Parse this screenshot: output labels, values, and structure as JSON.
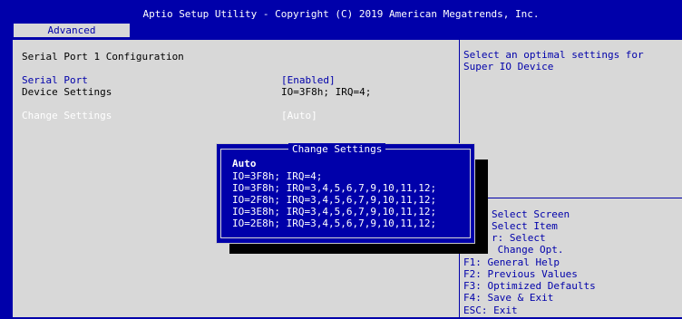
{
  "header": {
    "title": "Aptio Setup Utility - Copyright (C) 2019 American Megatrends, Inc.",
    "tab": "Advanced"
  },
  "main": {
    "section_title": "Serial Port 1 Configuration",
    "rows": [
      {
        "label": "Serial Port",
        "value": "[Enabled]"
      },
      {
        "label": "Device Settings",
        "value": "IO=3F8h; IRQ=4;"
      },
      {
        "label": "Change Settings",
        "value": "[Auto]"
      }
    ]
  },
  "help": {
    "description": [
      "Select an optimal settings for",
      "Super IO Device"
    ],
    "keys": [
      "Select Screen",
      "Select Item",
      "r: Select",
      " Change Opt.",
      "F1: General Help",
      "F2: Previous Values",
      "F3: Optimized Defaults",
      "F4: Save & Exit",
      "ESC: Exit"
    ]
  },
  "dialog": {
    "title": "Change Settings",
    "options": [
      "Auto",
      "IO=3F8h; IRQ=4;",
      "IO=3F8h; IRQ=3,4,5,6,7,9,10,11,12;",
      "IO=2F8h; IRQ=3,4,5,6,7,9,10,11,12;",
      "IO=3E8h; IRQ=3,4,5,6,7,9,10,11,12;",
      "IO=2E8h; IRQ=3,4,5,6,7,9,10,11,12;"
    ],
    "selected": "Auto"
  },
  "colors": {
    "background": "#0000aa",
    "panel": "#d8d8d8",
    "text": "#000000",
    "accent": "#0000aa",
    "highlight": "#ffffff"
  }
}
